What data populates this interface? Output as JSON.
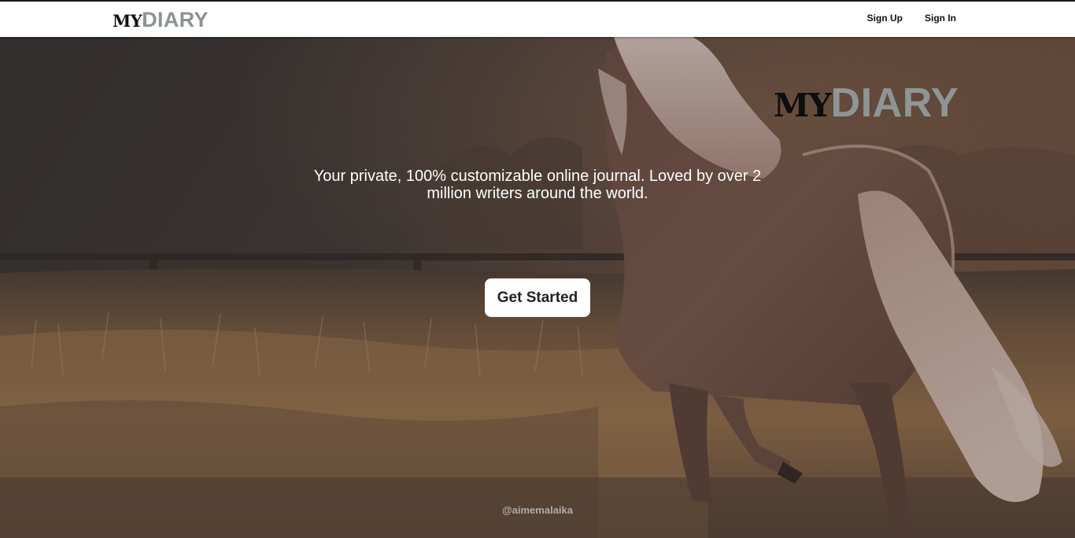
{
  "navbar": {
    "logo": {
      "my": "MY",
      "diary": "DIARY"
    },
    "links": {
      "sign_up": "Sign Up",
      "sign_in": "Sign In"
    }
  },
  "hero": {
    "logo": {
      "my": "MY",
      "diary": "DIARY"
    },
    "tagline": "Your private, 100% customizable online journal. Loved by over 2 million writers around the world.",
    "cta_label": "Get Started",
    "credit": "@aimemalaika",
    "background_icon": "horse-in-field-photo"
  },
  "colors": {
    "logo_my": "#111111",
    "logo_diary": "#8d9393",
    "nav_background": "#ffffff",
    "cta_background": "#ffffff",
    "cta_text": "#1f2326",
    "overlay": "#3a3535"
  }
}
